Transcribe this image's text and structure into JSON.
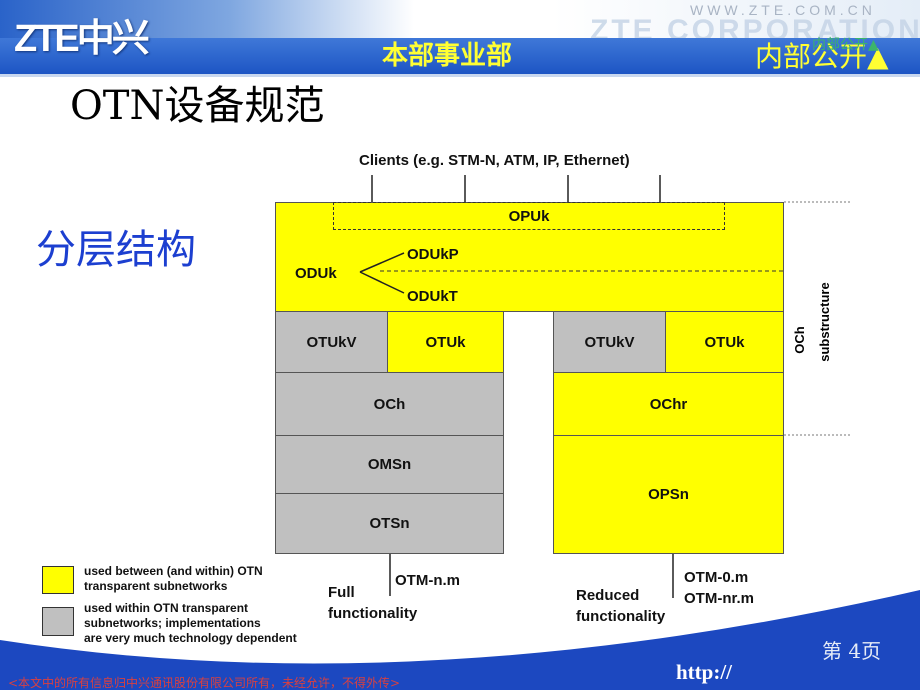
{
  "header": {
    "logo": "ZTE中兴",
    "website": "WWW.ZTE.COM.CN",
    "corp_watermark": "ZTE CORPORATION",
    "department": "本部事业部",
    "classification": "内部公开▲",
    "classification_overlay": "内部公开▲"
  },
  "slide": {
    "title": "OTN设备规范",
    "subtitle": "分层结构"
  },
  "diagram": {
    "clients": "Clients (e.g. STM-N, ATM, IP, Ethernet)",
    "opuk": "OPUk",
    "oduk": "ODUk",
    "odukp": "ODUkP",
    "odukt": "ODUkT",
    "left": {
      "otukv": "OTUkV",
      "otuk": "OTUk",
      "och": "OCh",
      "omsn": "OMSn",
      "otsn": "OTSn",
      "otm": "OTM-n.m",
      "func_line1": "Full",
      "func_line2": "functionality"
    },
    "right": {
      "otukv": "OTUkV",
      "otuk": "OTUk",
      "ochr": "OChr",
      "opsn": "OPSn",
      "otm1": "OTM-0.m",
      "otm2": "OTM-nr.m",
      "func_line1": "Reduced",
      "func_line2": "functionality"
    },
    "side_label_1": "OCh",
    "side_label_2": "substructure",
    "legend": [
      {
        "color": "#ffff00",
        "line1": "used between (and within) OTN",
        "line2": "transparent subnetworks"
      },
      {
        "color": "#c0c0c0",
        "line1": "used within OTN transparent",
        "line2": "subnetworks; implementations",
        "line3": "are very much technology dependent"
      }
    ]
  },
  "footer": {
    "page": "第 4页",
    "url": "http://",
    "legal": "<本文中的所有信息归中兴通讯股份有限公司所有，未经允许，不得外传>"
  },
  "colors": {
    "yellow": "#ffff00",
    "gray": "#c0c0c0",
    "band_blue": "#1d55c4",
    "subtitle_blue": "#1c3fd0"
  }
}
